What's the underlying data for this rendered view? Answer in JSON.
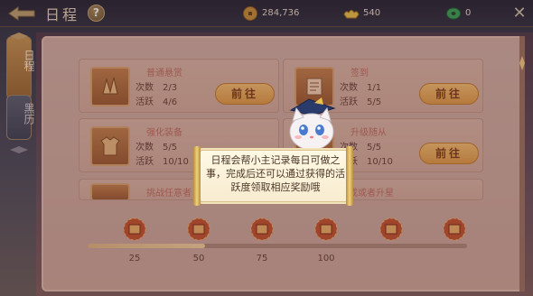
{
  "header": {
    "title": "日程",
    "help": "?",
    "currencies": [
      {
        "icon": "copper-coin-icon",
        "value": "284,736"
      },
      {
        "icon": "gold-ingot-icon",
        "value": "540"
      },
      {
        "icon": "jade-icon",
        "value": "0"
      }
    ],
    "close": "✕"
  },
  "tabs": [
    {
      "label": "日程",
      "active": true
    },
    {
      "label": "黑历",
      "active": false
    }
  ],
  "activities": [
    {
      "name": "普通悬赏",
      "count_label": "次数",
      "count": "2/3",
      "active_label": "活跃",
      "active": "4/6",
      "button": "前往",
      "icon": "bounty-icon"
    },
    {
      "name": "签到",
      "count_label": "次数",
      "count": "1/1",
      "active_label": "活跃",
      "active": "5/5",
      "button": "前往",
      "icon": "scroll-icon"
    },
    {
      "name": "强化装备",
      "count_label": "次数",
      "count": "5/5",
      "active_label": "活跃",
      "active": "10/10",
      "button": "",
      "icon": "armor-icon"
    },
    {
      "name": "升级随从",
      "count_label": "次数",
      "count": "5/5",
      "active_label": "活跃",
      "active": "10/10",
      "button": "前往",
      "icon": "follower-icon"
    },
    {
      "name": "挑战任意者",
      "icon": "challenge-icon"
    },
    {
      "name": "完成或者升星",
      "icon": "star-icon"
    }
  ],
  "progress": {
    "fraction": 0.31,
    "milestones": [
      "25",
      "50",
      "75",
      "100"
    ]
  },
  "tooltip": {
    "text": "日程会帮小主记录每日可做之事，完成后还可以通过获得的活跃度领取相应奖励哦"
  },
  "colors": {
    "panel": "#c9c0b5",
    "button_gold": "#e5bb60",
    "activity_name": "#b4776a"
  }
}
